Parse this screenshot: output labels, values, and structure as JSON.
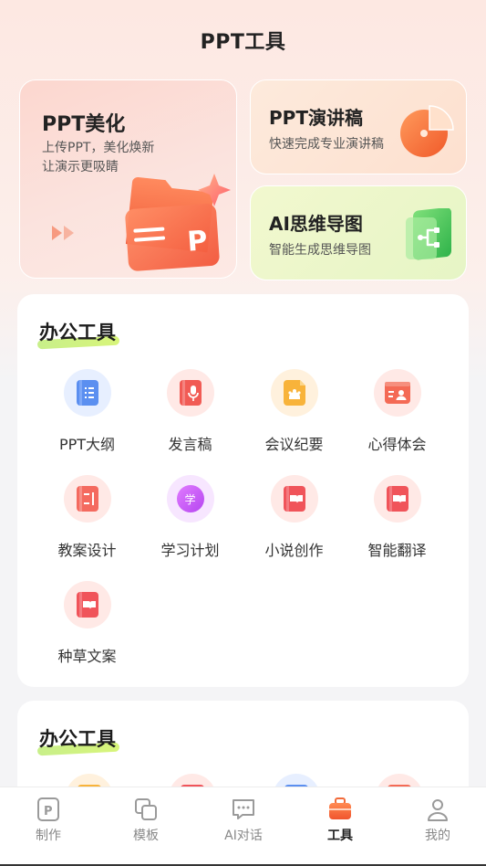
{
  "header": {
    "title": "PPT工具"
  },
  "hero": {
    "beautify": {
      "title": "PPT美化",
      "line1": "上传PPT，美化焕新",
      "line2": "让演示更吸睛",
      "folder_letter": "P"
    },
    "speech": {
      "title": "PPT演讲稿",
      "subtitle": "快速完成专业演讲稿"
    },
    "mindmap": {
      "title": "AI思维导图",
      "subtitle": "智能生成思维导图"
    }
  },
  "sections": [
    {
      "title": "办公工具",
      "tools": [
        {
          "label": "PPT大纲",
          "icon": "outline-icon"
        },
        {
          "label": "发言稿",
          "icon": "microphone-icon"
        },
        {
          "label": "会议纪要",
          "icon": "meeting-icon"
        },
        {
          "label": "心得体会",
          "icon": "person-card-icon"
        },
        {
          "label": "教案设计",
          "icon": "lesson-plan-icon"
        },
        {
          "label": "学习计划",
          "icon": "study-icon",
          "glyph": "学"
        },
        {
          "label": "小说创作",
          "icon": "book-icon"
        },
        {
          "label": "智能翻译",
          "icon": "translate-book-icon"
        },
        {
          "label": "种草文案",
          "icon": "copywriting-icon"
        }
      ]
    },
    {
      "title": "办公工具"
    }
  ],
  "tabbar": {
    "items": [
      {
        "label": "制作",
        "icon": "make-icon"
      },
      {
        "label": "模板",
        "icon": "template-icon"
      },
      {
        "label": "AI对话",
        "icon": "chat-icon"
      },
      {
        "label": "工具",
        "icon": "toolbox-icon",
        "active": true
      },
      {
        "label": "我的",
        "icon": "profile-icon"
      }
    ]
  },
  "colors": {
    "accent": "#f2643f",
    "active_tab": "#f26b3a",
    "inactive_tab": "#9a9a9a",
    "underline": "#cdf07f"
  }
}
